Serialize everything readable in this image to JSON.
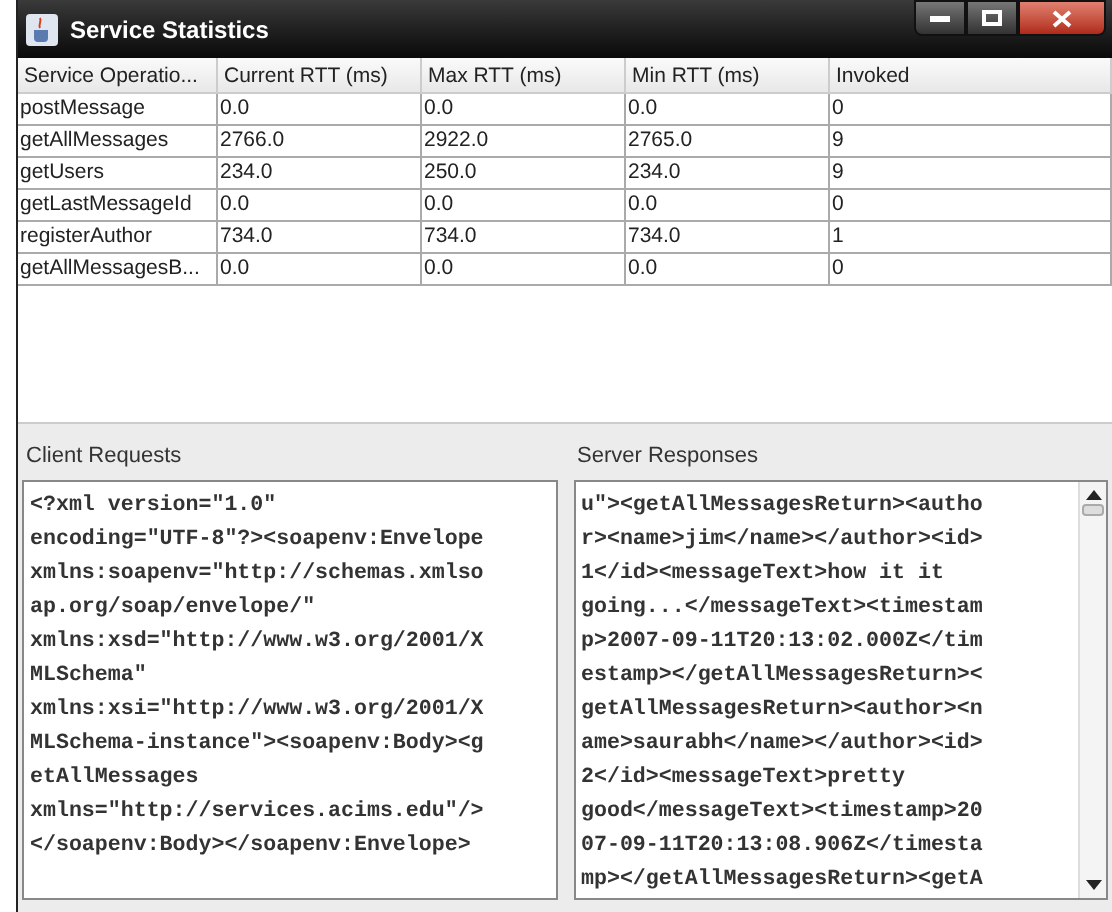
{
  "window": {
    "title": "Service Statistics"
  },
  "table": {
    "columns": [
      "Service Operatio...",
      "Current RTT (ms)",
      "Max RTT (ms)",
      "Min RTT (ms)",
      "Invoked"
    ],
    "rows": [
      [
        "postMessage",
        "0.0",
        "0.0",
        "0.0",
        "0"
      ],
      [
        "getAllMessages",
        "2766.0",
        "2922.0",
        "2765.0",
        "9"
      ],
      [
        "getUsers",
        "234.0",
        "250.0",
        "234.0",
        "9"
      ],
      [
        "getLastMessageId",
        "0.0",
        "0.0",
        "0.0",
        "0"
      ],
      [
        "registerAuthor",
        "734.0",
        "734.0",
        "734.0",
        "1"
      ],
      [
        "getAllMessagesB...",
        "0.0",
        "0.0",
        "0.0",
        "0"
      ]
    ]
  },
  "client_requests": {
    "label": "Client Requests",
    "lines": [
      "<?xml version=\"1.0\"",
      "encoding=\"UTF-8\"?><soapenv:Envelope",
      "xmlns:soapenv=\"http://schemas.xmlso",
      "ap.org/soap/envelope/\"",
      "xmlns:xsd=\"http://www.w3.org/2001/X",
      "MLSchema\"",
      "xmlns:xsi=\"http://www.w3.org/2001/X",
      "MLSchema-instance\"><soapenv:Body><g",
      "etAllMessages",
      "xmlns=\"http://services.acims.edu\"/>",
      "</soapenv:Body></soapenv:Envelope>"
    ]
  },
  "server_responses": {
    "label": "Server Responses",
    "lines": [
      "u\"><getAllMessagesReturn><autho",
      "r><name>jim</name></author><id>",
      "1</id><messageText>how it it",
      "going...</messageText><timestam",
      "p>2007-09-11T20:13:02.000Z</tim",
      "estamp></getAllMessagesReturn><",
      "getAllMessagesReturn><author><n",
      "ame>saurabh</name></author><id>",
      "2</id><messageText>pretty",
      "good</messageText><timestamp>20",
      "07-09-11T20:13:08.906Z</timesta",
      "mp></getAllMessagesReturn><getA"
    ]
  }
}
